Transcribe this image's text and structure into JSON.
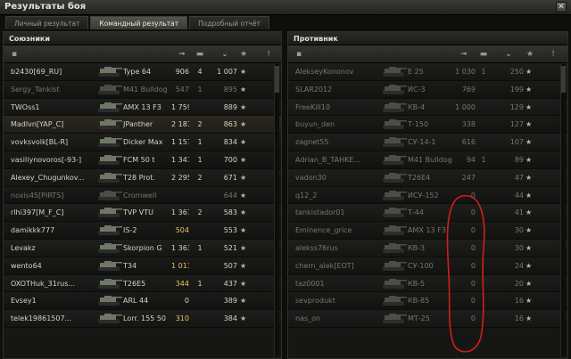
{
  "window": {
    "title": "Результаты боя",
    "close_icon": "close-icon"
  },
  "tabs": [
    {
      "label": "Личный результат",
      "active": false
    },
    {
      "label": "Командный результат",
      "active": true
    },
    {
      "label": "Подробный отчёт",
      "active": false
    }
  ],
  "allies": {
    "title": "Союзники",
    "rows": [
      {
        "player": "b2430[69_RU]",
        "tank": "Type 64",
        "c1": "906",
        "c2": "4",
        "c3": "1 007",
        "dead": false,
        "hl": false
      },
      {
        "player": "Sergy_Tankist",
        "tank": "M41 Bulldog",
        "c1": "547",
        "c2": "1",
        "c3": "895",
        "dead": true,
        "hl": false
      },
      {
        "player": "TWOss1",
        "tank": "AMX 13 F3",
        "c1": "1 759",
        "c2": "",
        "c3": "889",
        "dead": false,
        "hl": false
      },
      {
        "player": "Madlvn[YAP_C]",
        "tank": "JPanther",
        "c1": "2 181",
        "c2": "2",
        "c3": "863",
        "dead": false,
        "hl": true
      },
      {
        "player": "vovksvolk[BL-R]",
        "tank": "Dicker Max",
        "c1": "1 157",
        "c2": "1",
        "c3": "834",
        "dead": false,
        "hl": false
      },
      {
        "player": "vasiliynovoros[-93-]",
        "tank": "FCM 50 t",
        "c1": "1 341",
        "c2": "1",
        "c3": "700",
        "dead": false,
        "hl": false
      },
      {
        "player": "Alexey_Chugunkov...",
        "tank": "T28 Prot.",
        "c1": "2 295",
        "c2": "2",
        "c3": "671",
        "dead": false,
        "hl": false
      },
      {
        "player": "noxis45[PIRTS]",
        "tank": "Cromwell",
        "c1": "",
        "c2": "",
        "c3": "644",
        "dead": true,
        "hl": false
      },
      {
        "player": "rlhi397[M_F_C]",
        "tank": "TVP VTU",
        "c1": "1 367",
        "c2": "2",
        "c3": "583",
        "dead": false,
        "hl": false
      },
      {
        "player": "damikkk777",
        "tank": "IS-2",
        "c1": "504",
        "c2": "",
        "c3": "553",
        "dead": false,
        "hl": false
      },
      {
        "player": "Levakz",
        "tank": "Skorpion G",
        "c1": "1 363",
        "c2": "1",
        "c3": "521",
        "dead": false,
        "hl": false
      },
      {
        "player": "wento64",
        "tank": "T34",
        "c1": "1 013",
        "c2": "",
        "c3": "507",
        "dead": false,
        "hl": false
      },
      {
        "player": "OXOTHuk_31rus...",
        "tank": "T26E5",
        "c1": "344",
        "c2": "1",
        "c3": "437",
        "dead": false,
        "hl": false
      },
      {
        "player": "Evsey1",
        "tank": "ARL 44",
        "c1": "0",
        "c2": "",
        "c3": "389",
        "dead": false,
        "hl": false
      },
      {
        "player": "telek19861507...",
        "tank": "Lorr. 155 50",
        "c1": "310",
        "c2": "",
        "c3": "384",
        "dead": false,
        "hl": false
      }
    ]
  },
  "enemies": {
    "title": "Противник",
    "rows": [
      {
        "player": "AlekseyKononov",
        "tank": "E 25",
        "c1": "1 030",
        "c2": "1",
        "c3": "250",
        "dead": true
      },
      {
        "player": "SLAR2012",
        "tank": "ИС-3",
        "c1": "769",
        "c2": "",
        "c3": "199",
        "dead": true
      },
      {
        "player": "FreeKill10",
        "tank": "КВ-4",
        "c1": "1 000",
        "c2": "",
        "c3": "129",
        "dead": true
      },
      {
        "player": "buyun_den",
        "tank": "Т-150",
        "c1": "338",
        "c2": "",
        "c3": "127",
        "dead": true
      },
      {
        "player": "zagnet55",
        "tank": "СУ-14-1",
        "c1": "616",
        "c2": "",
        "c3": "107",
        "dead": true
      },
      {
        "player": "Adrian_B_TAHKE...",
        "tank": "M41 Bulldog",
        "c1": "94",
        "c2": "1",
        "c3": "89",
        "dead": true
      },
      {
        "player": "vadon30",
        "tank": "T26E4",
        "c1": "247",
        "c2": "",
        "c3": "47",
        "dead": true
      },
      {
        "player": "q12_2",
        "tank": "ИСУ-152",
        "c1": "0",
        "c2": "",
        "c3": "44",
        "dead": true
      },
      {
        "player": "tankistador01",
        "tank": "Т-44",
        "c1": "0",
        "c2": "",
        "c3": "41",
        "dead": true
      },
      {
        "player": "Eminence_grice",
        "tank": "AMX 13 F3",
        "c1": "0",
        "c2": "",
        "c3": "30",
        "dead": true
      },
      {
        "player": "alekss76rus",
        "tank": "КВ-3",
        "c1": "0",
        "c2": "",
        "c3": "30",
        "dead": true
      },
      {
        "player": "chern_alek[EOT]",
        "tank": "СУ-100",
        "c1": "0",
        "c2": "",
        "c3": "24",
        "dead": true
      },
      {
        "player": "taz0001",
        "tank": "КВ-5",
        "c1": "0",
        "c2": "",
        "c3": "20",
        "dead": true
      },
      {
        "player": "sevprodukt",
        "tank": "КВ-85",
        "c1": "0",
        "c2": "",
        "c3": "16",
        "dead": true
      },
      {
        "player": "nas_on",
        "tank": "МТ-25",
        "c1": "0",
        "c2": "",
        "c3": "16",
        "dead": true
      }
    ]
  },
  "colors": {
    "gold": "#e7c75a",
    "annotation": "#d0201a"
  }
}
